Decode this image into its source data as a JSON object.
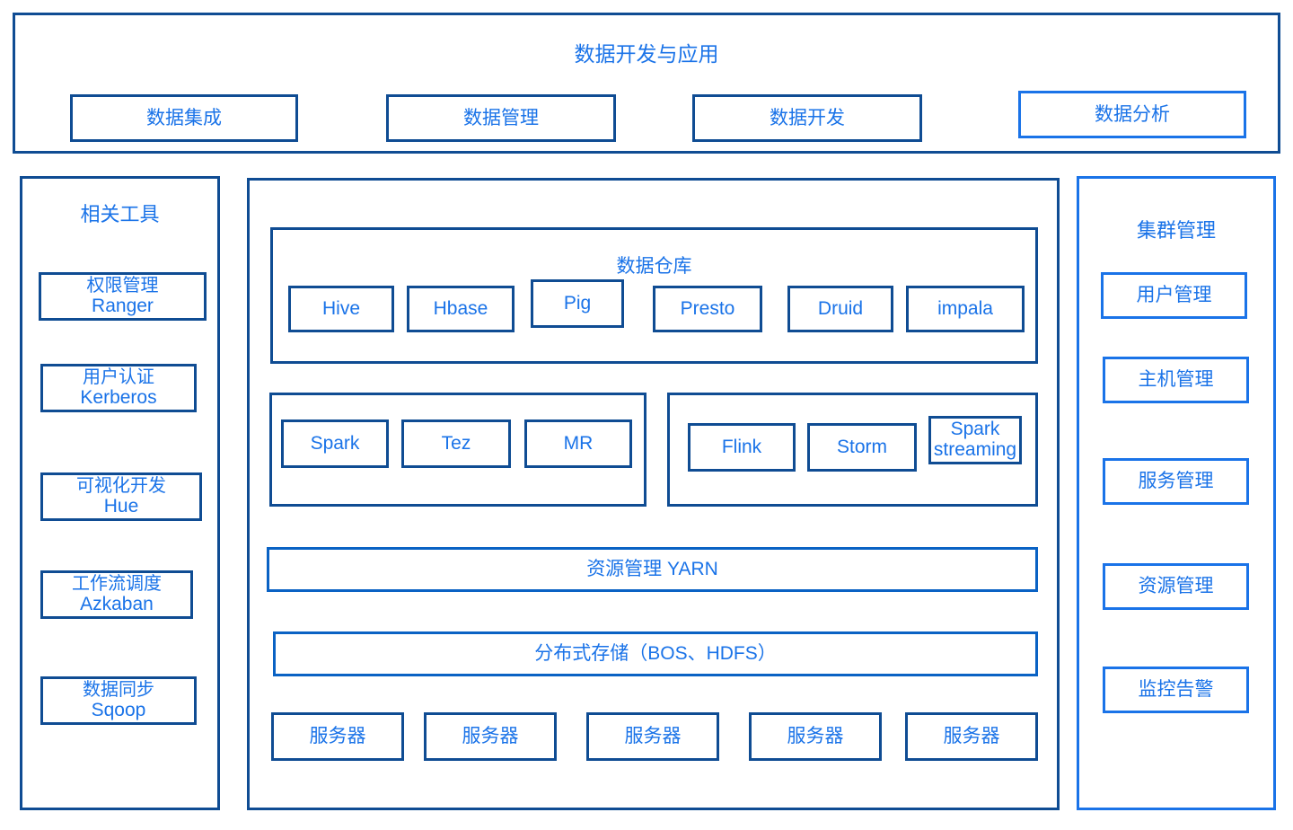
{
  "top": {
    "title": "数据开发与应用",
    "items": [
      {
        "label": "数据集成"
      },
      {
        "label": "数据管理"
      },
      {
        "label": "数据开发"
      },
      {
        "label": "数据分析"
      }
    ]
  },
  "left_sidebar": {
    "title": "相关工具",
    "items": [
      {
        "line1": "权限管理",
        "line2": "Ranger"
      },
      {
        "line1": "用户认证",
        "line2": "Kerberos"
      },
      {
        "line1": "可视化开发",
        "line2": "Hue"
      },
      {
        "line1": "工作流调度",
        "line2": "Azkaban"
      },
      {
        "line1": "数据同步",
        "line2": "Sqoop"
      }
    ]
  },
  "right_sidebar": {
    "title": "集群管理",
    "items": [
      {
        "label": "用户管理"
      },
      {
        "label": "主机管理"
      },
      {
        "label": "服务管理"
      },
      {
        "label": "资源管理"
      },
      {
        "label": "监控告警"
      }
    ]
  },
  "middle": {
    "warehouse": {
      "title": "数据仓库",
      "items": [
        {
          "label": "Hive"
        },
        {
          "label": "Hbase"
        },
        {
          "label": "Pig"
        },
        {
          "label": "Presto"
        },
        {
          "label": "Druid"
        },
        {
          "label": "impala"
        }
      ]
    },
    "batch_engines": [
      {
        "label": "Spark"
      },
      {
        "label": "Tez"
      },
      {
        "label": "MR"
      }
    ],
    "stream_engines": [
      {
        "label": "Flink"
      },
      {
        "label": "Storm"
      },
      {
        "line1": "Spark",
        "line2": "streaming"
      }
    ],
    "resource_label": "资源管理 YARN",
    "storage_label": "分布式存储（BOS、HDFS）",
    "servers": [
      {
        "label": "服务器"
      },
      {
        "label": "服务器"
      },
      {
        "label": "服务器"
      },
      {
        "label": "服务器"
      },
      {
        "label": "服务器"
      }
    ]
  },
  "colors": {
    "text_blue": "#1a73e8",
    "border_navy": "#0f4c93",
    "border_bright": "#1a73e8",
    "border_mid": "#0a62c4"
  }
}
